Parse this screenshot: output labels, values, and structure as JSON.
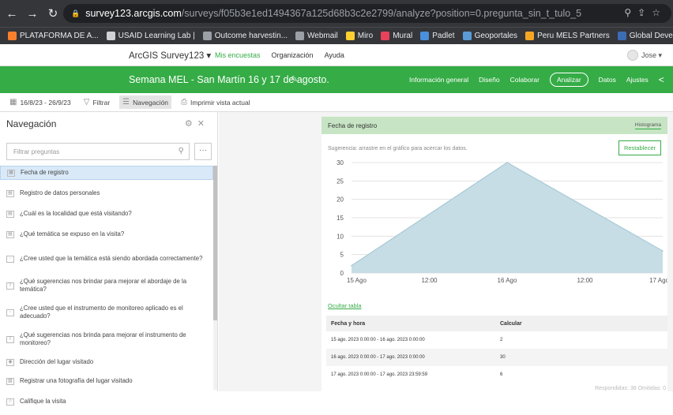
{
  "browser": {
    "url_host": "survey123.arcgis.com",
    "url_path": "/surveys/f05b3e1ed1494367a125d68b3c2e2799/analyze?position=0.pregunta_sin_t_tulo_5",
    "bookmarks": [
      {
        "label": "PLATAFORMA DE A...",
        "color": "#f9802d"
      },
      {
        "label": "USAID Learning Lab |",
        "color": "#cfd1d4"
      },
      {
        "label": "Outcome harvestin...",
        "color": "#9aa0a6"
      },
      {
        "label": "Webmail",
        "color": "#9aa0a6"
      },
      {
        "label": "Miro",
        "color": "#ffd02f"
      },
      {
        "label": "Mural",
        "color": "#e8425a"
      },
      {
        "label": "Padlet",
        "color": "#4a8fdc"
      },
      {
        "label": "Geoportales",
        "color": "#5b9bd5"
      },
      {
        "label": "Peru MELS Partners",
        "color": "#f6a623"
      },
      {
        "label": "Global Developmen...",
        "color": "#3c6db4"
      }
    ]
  },
  "app": {
    "title": "ArcGIS Survey123",
    "links": [
      "Mis encuestas",
      "Organización",
      "Ayuda"
    ],
    "user": "Jose"
  },
  "survey": {
    "name": "Semana MEL - San Martín 16 y 17 de agosto.",
    "tabs": [
      "Información general",
      "Diseño",
      "Colaborar",
      "Analizar",
      "Datos",
      "Ajustes"
    ],
    "active_tab": "Analizar"
  },
  "toolbar": {
    "date_range": "16/8/23 - 26/9/23",
    "filter": "Filtrar",
    "navigation": "Navegación",
    "print": "Imprimir vista actual"
  },
  "navigation": {
    "title": "Navegación",
    "filter_placeholder": "Filtrar preguntas",
    "questions": [
      {
        "label": "Fecha de registro",
        "icon": "calendar-icon"
      },
      {
        "label": "Registro de datos personales",
        "icon": "group-icon"
      },
      {
        "label": "¿Cuál es la localidad que está visitando?",
        "icon": "group-icon"
      },
      {
        "label": "¿Qué temática se expuso en la visita?",
        "icon": "group-icon"
      },
      {
        "label": "¿Cree usted que la temática está siendo abordada correctamente?",
        "icon": "choice-icon"
      },
      {
        "label": "¿Qué sugerencias nos brindar para mejorar el abordaje de la temática?",
        "icon": "text-icon"
      },
      {
        "label": "¿Cree usted que el instrumento de monitoreo aplicado es el adecuado?",
        "icon": "choice-icon"
      },
      {
        "label": "¿Qué sugerencias nos brinda para mejorar el instrumento de monitoreo?",
        "icon": "text-icon"
      },
      {
        "label": "Dirección del lugar visitado",
        "icon": "location-icon"
      },
      {
        "label": "Registrar una fotografía del lugar visitado",
        "icon": "image-icon"
      },
      {
        "label": "Califique la visita",
        "icon": "star-icon"
      }
    ]
  },
  "card": {
    "title": "Fecha de registro",
    "view_tab": "Histograma",
    "hint": "Sugerencia: arrastre en el gráfico para acercar los datos.",
    "reset_label": "Restablecer",
    "table_link": "Ocultar tabla",
    "table_headers": [
      "Fecha y hora",
      "Calcular"
    ],
    "table_rows": [
      [
        "15 ago. 2023 0:00:00 - 16 ago. 2023 0:00:00",
        "2"
      ],
      [
        "16 ago. 2023 0:00:00 - 17 ago. 2023 0:00:00",
        "30"
      ],
      [
        "17 ago. 2023 0:00:00 - 17 ago. 2023 23:59:59",
        "6"
      ]
    ],
    "footer": "Respondidas: 38 Omitidas: 0"
  },
  "chart_data": {
    "type": "area",
    "x": [
      "15 Ago",
      "16 Ago",
      "17 Ago"
    ],
    "tick_labels": [
      "15 Ago",
      "12:00",
      "16 Ago",
      "12:00",
      "17 Ago"
    ],
    "values": [
      2,
      30,
      6
    ],
    "ylim": [
      0,
      30
    ],
    "yticks": [
      0,
      5,
      10,
      15,
      20,
      25,
      30
    ],
    "grid": true,
    "fill_color": "#c6dde6",
    "line_color": "#9fc4d1"
  }
}
